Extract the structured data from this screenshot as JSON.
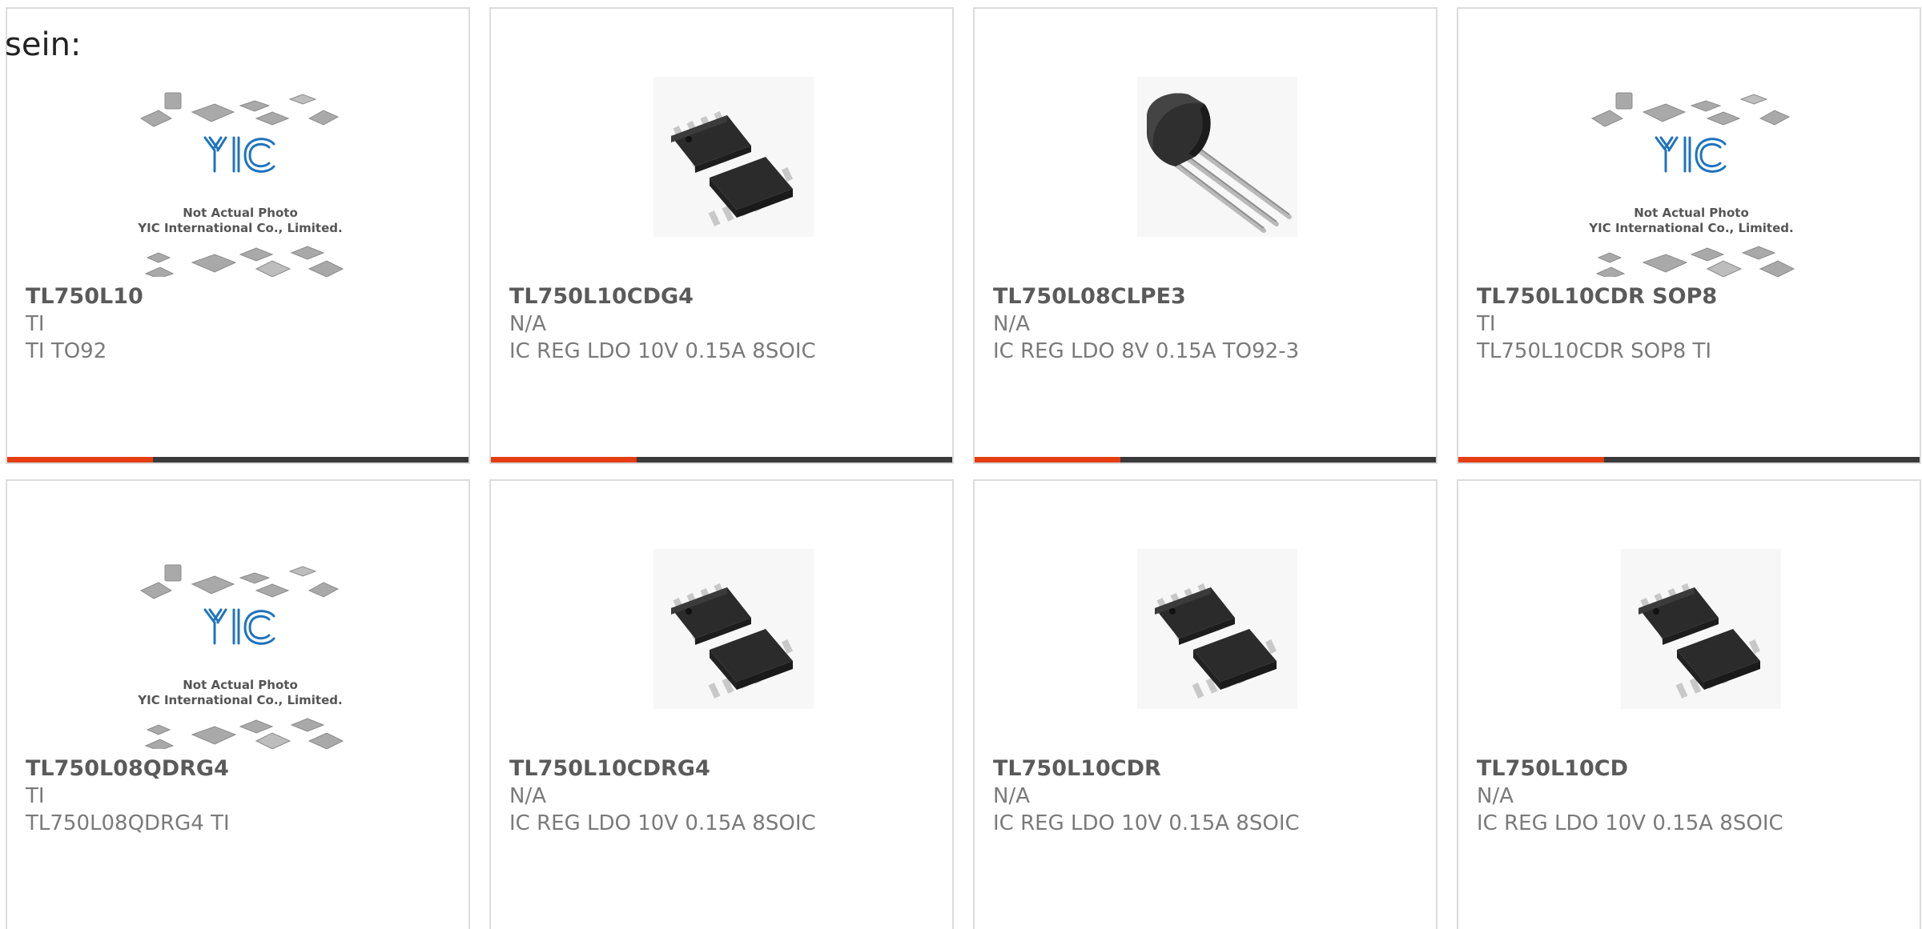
{
  "header": {
    "cut_text": "sein:"
  },
  "placeholder_photo": {
    "line1": "Not Actual Photo",
    "line2": "YIC International Co., Limited.",
    "logo": "YIC"
  },
  "colors": {
    "accent": "#e53d10",
    "bar_track": "#3a3a3a",
    "logo_blue": "#1e73be"
  },
  "product_bar_progress": 0.316,
  "products": [
    {
      "part": "TL750L10",
      "manufacturer": "TI",
      "description": "TI TO92",
      "image": "yic-placeholder"
    },
    {
      "part": "TL750L10CDG4",
      "manufacturer": "N/A",
      "description": "IC REG LDO 10V 0.15A 8SOIC",
      "image": "soic8-chip"
    },
    {
      "part": "TL750L08CLPE3",
      "manufacturer": "N/A",
      "description": "IC REG LDO 8V 0.15A TO92-3",
      "image": "to92-transistor"
    },
    {
      "part": "TL750L10CDR SOP8",
      "manufacturer": "TI",
      "description": "TL750L10CDR SOP8 TI",
      "image": "yic-placeholder"
    },
    {
      "part": "TL750L08QDRG4",
      "manufacturer": "TI",
      "description": "TL750L08QDRG4 TI",
      "image": "yic-placeholder"
    },
    {
      "part": "TL750L10CDRG4",
      "manufacturer": "N/A",
      "description": "IC REG LDO 10V 0.15A 8SOIC",
      "image": "soic8-chip"
    },
    {
      "part": "TL750L10CDR",
      "manufacturer": "N/A",
      "description": "IC REG LDO 10V 0.15A 8SOIC",
      "image": "soic8-chip"
    },
    {
      "part": "TL750L10CD",
      "manufacturer": "N/A",
      "description": "IC REG LDO 10V 0.15A 8SOIC",
      "image": "soic8-chip"
    }
  ]
}
